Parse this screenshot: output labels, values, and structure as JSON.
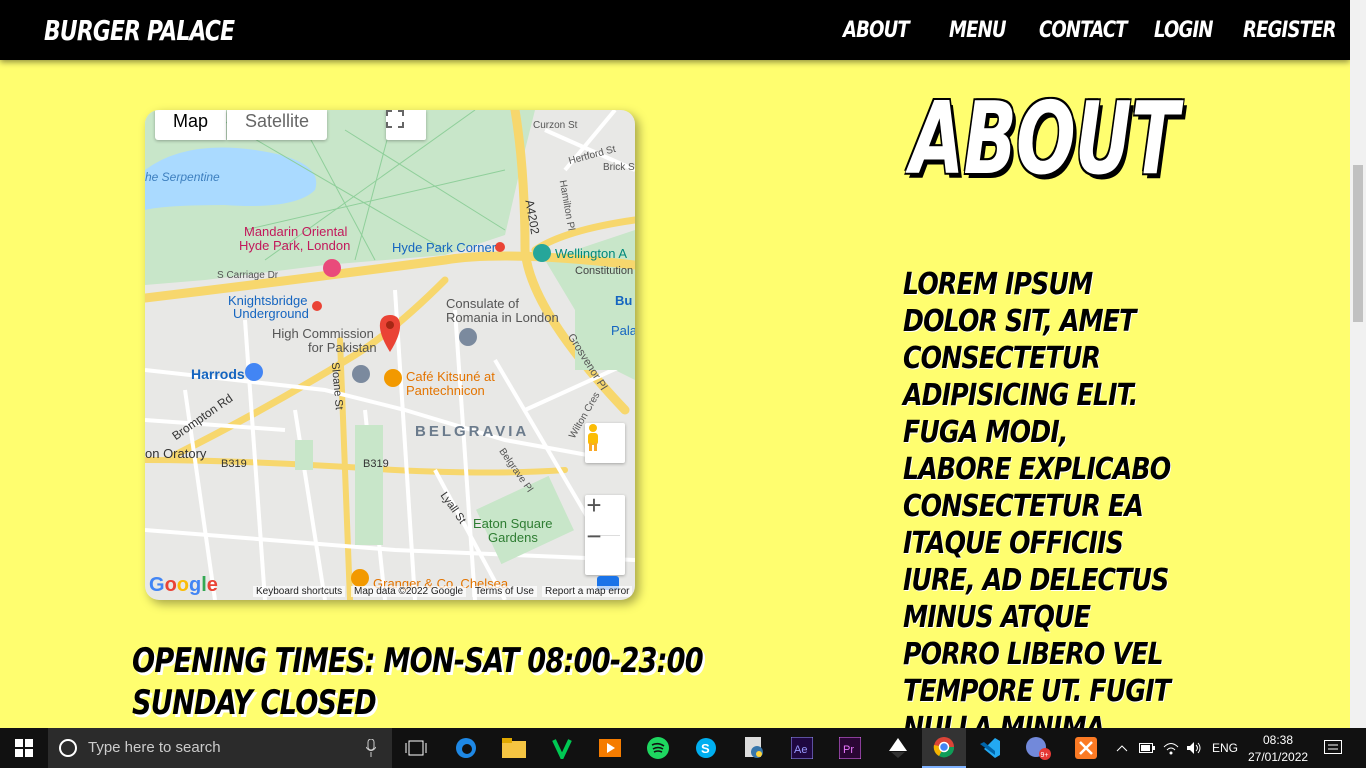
{
  "header": {
    "brand": "Burger Palace",
    "nav": [
      "About",
      "Menu",
      "Contact",
      "Login",
      "Register"
    ]
  },
  "map": {
    "tab_map": "Map",
    "tab_satellite": "Satellite",
    "labels": {
      "serpentine": "he Serpentine",
      "curzon": "Curzon St",
      "hertford": "Hertford St",
      "brick": "Brick St",
      "hamilton": "Hamilton Pl",
      "a4202": "A4202",
      "mandarin1": "Mandarin Oriental",
      "mandarin2": "Hyde Park, London",
      "hydecorner": "Hyde Park Corner",
      "wellington": "Wellington A",
      "constitution": "Constitution",
      "scarriage": "S Carriage Dr",
      "knights1": "Knightsbridge",
      "knights2": "Underground",
      "consulate1": "Consulate of",
      "consulate2": "Romania in London",
      "highcomm1": "High Commission",
      "highcomm2": "for Pakistan",
      "grosvenor": "Grosvenor Pl",
      "harrods": "Harrods",
      "cafe1": "Café Kitsuné at",
      "cafe2": "Pantechnicon",
      "brompton": "Brompton Rd",
      "belgravia": "BELGRAVIA",
      "oratory": "on Oratory",
      "b319a": "B319",
      "b319b": "B319",
      "sloane": "Sloane St",
      "wilton": "Wilton Cres",
      "eaton1": "Eaton Square",
      "eaton2": "Gardens",
      "belgrave": "Belgrave Pl",
      "lyall": "Lyall St",
      "granger": "Granger & Co. Chelsea",
      "bu": "Bu",
      "pala": "Pala"
    },
    "google": "Google",
    "keyboard": "Keyboard shortcuts",
    "mapdata": "Map data ©2022 Google",
    "terms": "Terms of Use",
    "report": "Report a map error"
  },
  "opening": {
    "line1": "Opening Times: Mon-Sat 08:00-23:00",
    "line2": "Sunday Closed"
  },
  "about": {
    "title": "About",
    "body": "Lorem ipsum dolor sit, amet consectetur adipisicing elit. Fuga modi, labore explicabo consectetur ea itaque officiis iure, ad delectus minus atque porro libero vel tempore ut. Fugit nulla minima molestias?"
  },
  "taskbar": {
    "search_placeholder": "Type here to search",
    "lang": "ENG",
    "time": "08:38",
    "date": "27/01/2022",
    "badge": "9+"
  }
}
